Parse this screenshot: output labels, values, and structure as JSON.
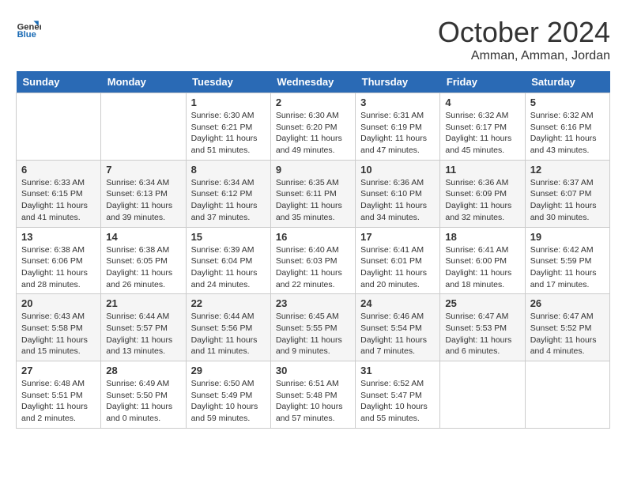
{
  "header": {
    "logo_general": "General",
    "logo_blue": "Blue",
    "month_title": "October 2024",
    "location": "Amman, Amman, Jordan"
  },
  "days_of_week": [
    "Sunday",
    "Monday",
    "Tuesday",
    "Wednesday",
    "Thursday",
    "Friday",
    "Saturday"
  ],
  "weeks": [
    [
      {
        "day": "",
        "info": ""
      },
      {
        "day": "",
        "info": ""
      },
      {
        "day": "1",
        "info": "Sunrise: 6:30 AM\nSunset: 6:21 PM\nDaylight: 11 hours and 51 minutes."
      },
      {
        "day": "2",
        "info": "Sunrise: 6:30 AM\nSunset: 6:20 PM\nDaylight: 11 hours and 49 minutes."
      },
      {
        "day": "3",
        "info": "Sunrise: 6:31 AM\nSunset: 6:19 PM\nDaylight: 11 hours and 47 minutes."
      },
      {
        "day": "4",
        "info": "Sunrise: 6:32 AM\nSunset: 6:17 PM\nDaylight: 11 hours and 45 minutes."
      },
      {
        "day": "5",
        "info": "Sunrise: 6:32 AM\nSunset: 6:16 PM\nDaylight: 11 hours and 43 minutes."
      }
    ],
    [
      {
        "day": "6",
        "info": "Sunrise: 6:33 AM\nSunset: 6:15 PM\nDaylight: 11 hours and 41 minutes."
      },
      {
        "day": "7",
        "info": "Sunrise: 6:34 AM\nSunset: 6:13 PM\nDaylight: 11 hours and 39 minutes."
      },
      {
        "day": "8",
        "info": "Sunrise: 6:34 AM\nSunset: 6:12 PM\nDaylight: 11 hours and 37 minutes."
      },
      {
        "day": "9",
        "info": "Sunrise: 6:35 AM\nSunset: 6:11 PM\nDaylight: 11 hours and 35 minutes."
      },
      {
        "day": "10",
        "info": "Sunrise: 6:36 AM\nSunset: 6:10 PM\nDaylight: 11 hours and 34 minutes."
      },
      {
        "day": "11",
        "info": "Sunrise: 6:36 AM\nSunset: 6:09 PM\nDaylight: 11 hours and 32 minutes."
      },
      {
        "day": "12",
        "info": "Sunrise: 6:37 AM\nSunset: 6:07 PM\nDaylight: 11 hours and 30 minutes."
      }
    ],
    [
      {
        "day": "13",
        "info": "Sunrise: 6:38 AM\nSunset: 6:06 PM\nDaylight: 11 hours and 28 minutes."
      },
      {
        "day": "14",
        "info": "Sunrise: 6:38 AM\nSunset: 6:05 PM\nDaylight: 11 hours and 26 minutes."
      },
      {
        "day": "15",
        "info": "Sunrise: 6:39 AM\nSunset: 6:04 PM\nDaylight: 11 hours and 24 minutes."
      },
      {
        "day": "16",
        "info": "Sunrise: 6:40 AM\nSunset: 6:03 PM\nDaylight: 11 hours and 22 minutes."
      },
      {
        "day": "17",
        "info": "Sunrise: 6:41 AM\nSunset: 6:01 PM\nDaylight: 11 hours and 20 minutes."
      },
      {
        "day": "18",
        "info": "Sunrise: 6:41 AM\nSunset: 6:00 PM\nDaylight: 11 hours and 18 minutes."
      },
      {
        "day": "19",
        "info": "Sunrise: 6:42 AM\nSunset: 5:59 PM\nDaylight: 11 hours and 17 minutes."
      }
    ],
    [
      {
        "day": "20",
        "info": "Sunrise: 6:43 AM\nSunset: 5:58 PM\nDaylight: 11 hours and 15 minutes."
      },
      {
        "day": "21",
        "info": "Sunrise: 6:44 AM\nSunset: 5:57 PM\nDaylight: 11 hours and 13 minutes."
      },
      {
        "day": "22",
        "info": "Sunrise: 6:44 AM\nSunset: 5:56 PM\nDaylight: 11 hours and 11 minutes."
      },
      {
        "day": "23",
        "info": "Sunrise: 6:45 AM\nSunset: 5:55 PM\nDaylight: 11 hours and 9 minutes."
      },
      {
        "day": "24",
        "info": "Sunrise: 6:46 AM\nSunset: 5:54 PM\nDaylight: 11 hours and 7 minutes."
      },
      {
        "day": "25",
        "info": "Sunrise: 6:47 AM\nSunset: 5:53 PM\nDaylight: 11 hours and 6 minutes."
      },
      {
        "day": "26",
        "info": "Sunrise: 6:47 AM\nSunset: 5:52 PM\nDaylight: 11 hours and 4 minutes."
      }
    ],
    [
      {
        "day": "27",
        "info": "Sunrise: 6:48 AM\nSunset: 5:51 PM\nDaylight: 11 hours and 2 minutes."
      },
      {
        "day": "28",
        "info": "Sunrise: 6:49 AM\nSunset: 5:50 PM\nDaylight: 11 hours and 0 minutes."
      },
      {
        "day": "29",
        "info": "Sunrise: 6:50 AM\nSunset: 5:49 PM\nDaylight: 10 hours and 59 minutes."
      },
      {
        "day": "30",
        "info": "Sunrise: 6:51 AM\nSunset: 5:48 PM\nDaylight: 10 hours and 57 minutes."
      },
      {
        "day": "31",
        "info": "Sunrise: 6:52 AM\nSunset: 5:47 PM\nDaylight: 10 hours and 55 minutes."
      },
      {
        "day": "",
        "info": ""
      },
      {
        "day": "",
        "info": ""
      }
    ]
  ]
}
